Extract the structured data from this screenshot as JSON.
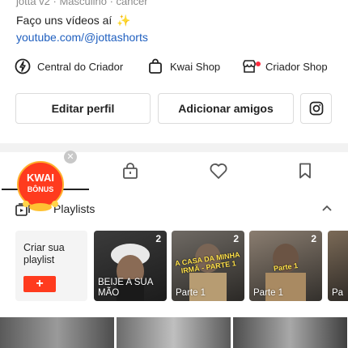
{
  "profile": {
    "meta_line": "jotta v2 · Masculino · câncer",
    "bio": "Faço uns vídeos aí",
    "bio_emoji": "✨",
    "link": "youtube.com/@jottashorts"
  },
  "shortcuts": [
    {
      "label": "Central do Criador",
      "icon": "lightning-icon"
    },
    {
      "label": "Kwai Shop",
      "icon": "shopping-bag-icon"
    },
    {
      "label": "Criador Shop",
      "icon": "shop-icon"
    }
  ],
  "actions": {
    "edit_profile": "Editar perfil",
    "add_friends": "Adicionar amigos"
  },
  "badge": {
    "line1": "KWAI",
    "line2": "BÔNUS"
  },
  "playlists": {
    "title": "Playlists",
    "create_label": "Criar sua playlist",
    "create_button": "+",
    "items": [
      {
        "count": "2",
        "label": "BEIJE A SUA MÃO",
        "caption": ""
      },
      {
        "count": "2",
        "label": "Parte 1",
        "caption": "A CASA DA MINHA IRMÃ - PARTE 1"
      },
      {
        "count": "2",
        "label": "Parte 1",
        "caption": "Parte 1"
      },
      {
        "count": "",
        "label": "Pa",
        "caption": ""
      }
    ]
  },
  "colors": {
    "accent": "#ff3b1e",
    "link": "#1f5fbf",
    "badge": "#ff3b1e"
  }
}
